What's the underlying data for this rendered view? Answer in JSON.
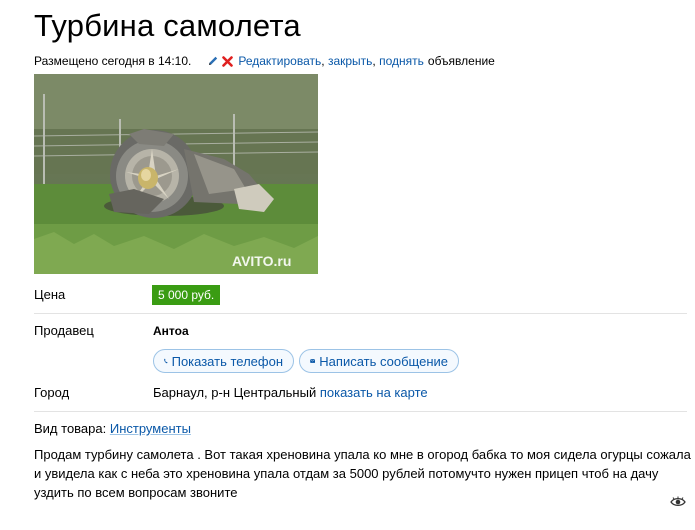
{
  "title": "Турбина самолета",
  "meta": {
    "posted": "Размещено сегодня в 14:10.",
    "edit_icon": "pencil-icon",
    "delete_icon": "red-x-icon",
    "edit_links": [
      "Редактировать",
      "закрыть",
      "поднять"
    ],
    "ad_word": "объявление"
  },
  "photo": {
    "watermark": "AVITO.ru"
  },
  "price": {
    "label": "Цена",
    "value": "5 000 руб.",
    "badge_color": "#3a9c13"
  },
  "seller": {
    "label": "Продавец",
    "name": "Антоа",
    "show_phone": "Показать телефон",
    "write_message": "Написать сообщение",
    "phone_icon": "phone-icon",
    "message_icon": "envelope-icon"
  },
  "city": {
    "label": "Город",
    "value": "Барнаул, р-н Центральный",
    "map_link": "показать на карте"
  },
  "goods": {
    "label": "Вид товара:",
    "value": "Инструменты"
  },
  "description": "Продам турбину самолета . Вот такая хреновина упала ко мне в огород бабка то моя сидела огурцы сожала и увидела как с неба это хреновина упала отдам за 5000 рублей потомучто нужен прицеп чтоб на дачу уздить по всем вопросам звоните",
  "colors": {
    "link": "#0a58a8",
    "button_border": "#9cc3e6",
    "button_bg": "#f4f9fe"
  }
}
